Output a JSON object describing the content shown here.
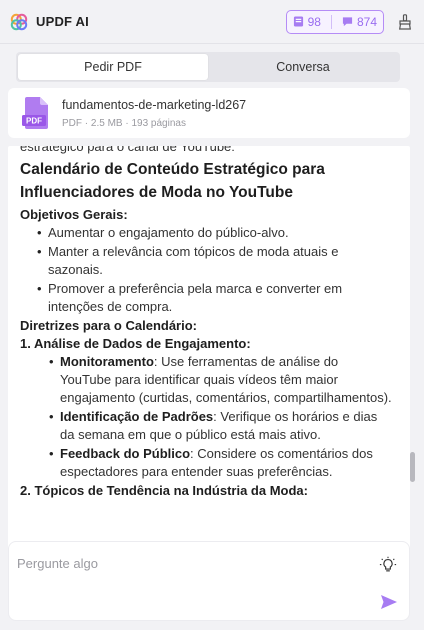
{
  "app": {
    "title": "UPDF AI"
  },
  "credits": {
    "pdf_count": "98",
    "chat_count": "874"
  },
  "colors": {
    "accent": "#9a6cf0",
    "pdf_badge": "#9a57e8"
  },
  "tabs": [
    {
      "label": "Pedir PDF",
      "active": true
    },
    {
      "label": "Conversa",
      "active": false
    }
  ],
  "file": {
    "badge": "PDF",
    "name": "fundamentos-de-marketing-ld267",
    "meta": "PDF · 2.5 MB · 193 páginas"
  },
  "message": {
    "intro_cut": "estratégico para o canal de YouTube:",
    "heading": "Calendário de Conteúdo Estratégico para Influenciadores de Moda no YouTube",
    "objectives_title": "Objetivos Gerais:",
    "objectives": [
      "Aumentar o engajamento do público-alvo.",
      "Manter a relevância com tópicos de moda atuais e sazonais.",
      "Promover a preferência pela marca e converter em intenções de compra."
    ],
    "guidelines_title": "Diretrizes para o Calendário:",
    "section1_title": "1. Análise de Dados de Engajamento:",
    "section1_items": [
      {
        "label": "Monitoramento",
        "text": ": Use ferramentas de análise do YouTube para identificar quais vídeos têm maior engajamento (curtidas, comentários, compartilhamentos)."
      },
      {
        "label": "Identificação de Padrões",
        "text": ": Verifique os horários e dias da semana em que o público está mais ativo."
      },
      {
        "label": "Feedback do Público",
        "text": ": Considere os comentários dos espectadores para entender suas preferências."
      }
    ],
    "section2_title": "2. Tópicos de Tendência na Indústria da Moda:"
  },
  "composer": {
    "placeholder": "Pergunte algo"
  }
}
